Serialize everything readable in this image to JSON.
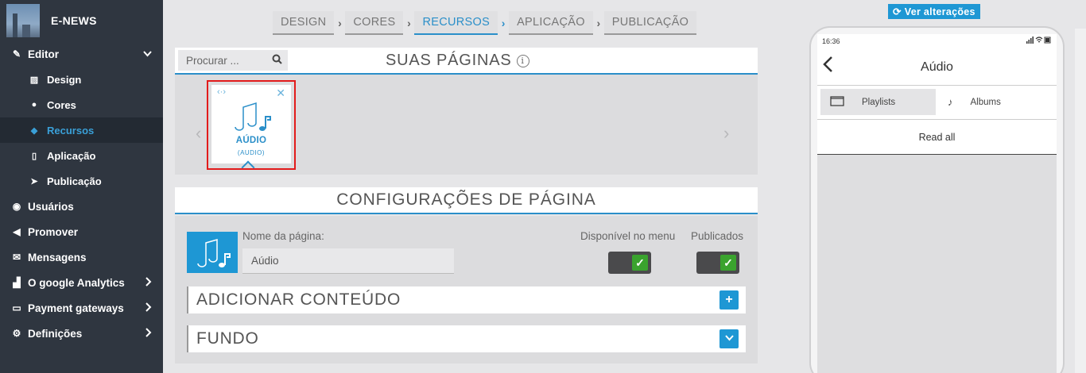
{
  "brand": {
    "name": "E-NEWS"
  },
  "sidebar": {
    "editor": {
      "label": "Editor",
      "icon": "pencil-icon"
    },
    "sub_items": [
      {
        "label": "Design",
        "icon": "image-icon"
      },
      {
        "label": "Cores",
        "icon": "palette-icon"
      },
      {
        "label": "Recursos",
        "icon": "cube-icon",
        "active": true
      },
      {
        "label": "Aplicação",
        "icon": "mobile-icon"
      },
      {
        "label": "Publicação",
        "icon": "send-icon"
      }
    ],
    "items": [
      {
        "label": "Usuários",
        "icon": "users-icon"
      },
      {
        "label": "Promover",
        "icon": "megaphone-icon"
      },
      {
        "label": "Mensagens",
        "icon": "envelope-icon"
      },
      {
        "label": "O google Analytics",
        "icon": "chart-icon"
      },
      {
        "label": "Payment gateways",
        "icon": "credit-card-icon"
      },
      {
        "label": "Definições",
        "icon": "cogs-icon"
      }
    ]
  },
  "wizard": {
    "steps": [
      {
        "label": "DESIGN"
      },
      {
        "label": "CORES"
      },
      {
        "label": "RECURSOS",
        "active": true
      },
      {
        "label": "APLICAÇÃO"
      },
      {
        "label": "PUBLICAÇÃO"
      }
    ]
  },
  "preview_button": {
    "label": "Ver alterações",
    "icon": "refresh-icon"
  },
  "pages": {
    "search_placeholder": "Procurar ...",
    "title": "SUAS PÁGINAS",
    "card": {
      "label": "AÚDIO",
      "sublabel": "(AUDIO)"
    }
  },
  "config": {
    "title": "CONFIGURAÇÕES DE PÁGINA",
    "name_label": "Nome da página:",
    "name_value": "Aúdio",
    "menu_label": "Disponível no menu",
    "published_label": "Publicados",
    "menu_enabled": true,
    "published_enabled": true,
    "add_content": "ADICIONAR CONTEÚDO",
    "background": "FUNDO"
  },
  "phone": {
    "time": "16:36",
    "title": "Aúdio",
    "tabs": [
      {
        "label": "Playlists",
        "icon": "folder-icon",
        "active": true
      },
      {
        "label": "Albums",
        "icon": "music-note-icon"
      }
    ],
    "read_all": "Read all"
  },
  "colors": {
    "accent": "#1e97d4",
    "sidebar_bg": "#2f3640",
    "highlight_border": "#e21b1b",
    "toggle_on": "#3aa32e"
  }
}
